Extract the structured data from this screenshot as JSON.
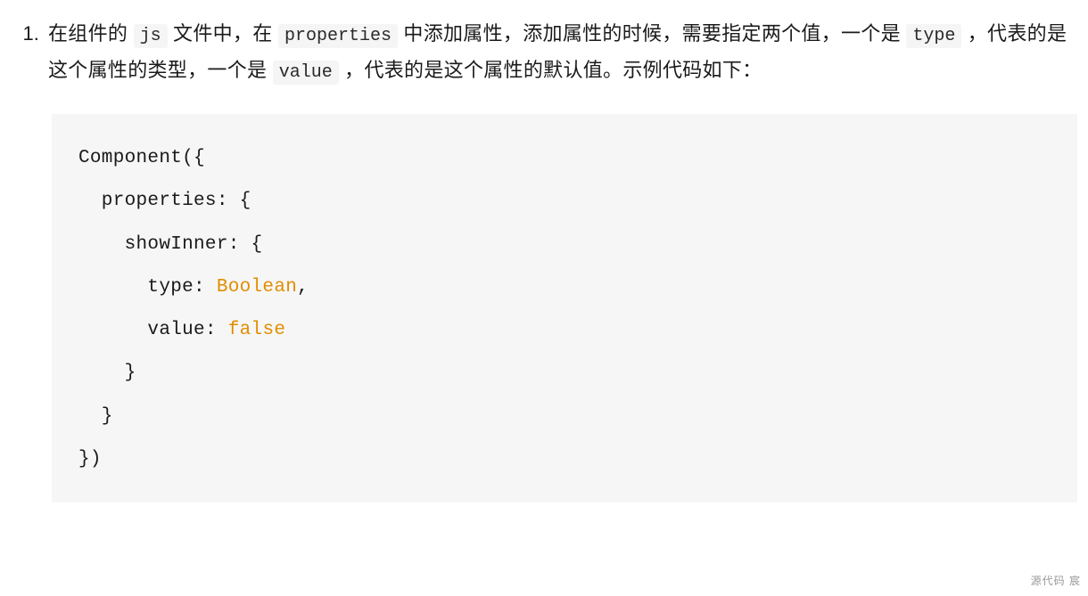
{
  "list": {
    "item1": {
      "seg1": "在组件的 ",
      "code1": "js",
      "seg2": " 文件中，在 ",
      "code2": "properties",
      "seg3": " 中添加属性，添加属性的时候，需要指定两个值，一个是 ",
      "code3": "type",
      "seg4": " ，代表的是这个属性的类型，一个是 ",
      "code4": "value",
      "seg5": " ，代表的是这个属性的默认值。示例代码如下："
    }
  },
  "code": {
    "l1a": "Component({",
    "l2a": "  properties: {",
    "l3a": "    showInner: {",
    "l4a": "      type: ",
    "l4b": "Boolean",
    "l4c": ",",
    "l5a": "      value: ",
    "l5b": "false",
    "l6a": "    }",
    "l7a": "  }",
    "l8a": "})"
  },
  "watermark": "源代码  宸"
}
